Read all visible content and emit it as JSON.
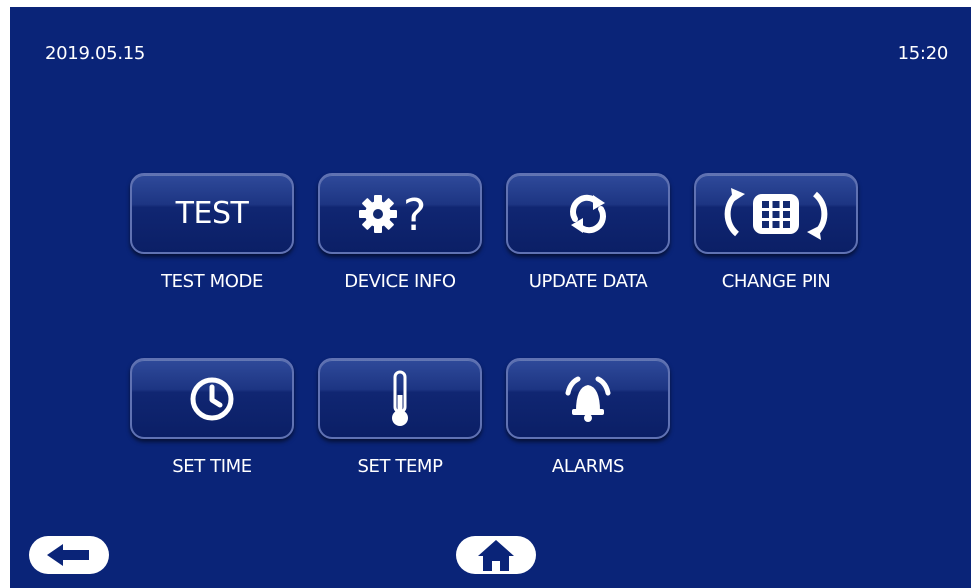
{
  "status": {
    "date": "2019.05.15",
    "time": "15:20"
  },
  "tiles": [
    {
      "tile_text": "TEST",
      "caption": "TEST MODE",
      "icon": "test-text"
    },
    {
      "caption": "DEVICE INFO",
      "icon": "gear-question-icon"
    },
    {
      "caption": "UPDATE DATA",
      "icon": "refresh-icon"
    },
    {
      "caption": "CHANGE PIN",
      "icon": "keypad-rotate-icon"
    },
    {
      "caption": "SET TIME",
      "icon": "clock-icon"
    },
    {
      "caption": "SET TEMP",
      "icon": "thermometer-icon"
    },
    {
      "caption": "ALARMS",
      "icon": "alarm-bell-icon"
    }
  ],
  "nav": {
    "back_icon": "arrow-left-icon",
    "home_icon": "home-icon"
  },
  "colors": {
    "background": "#0a2478",
    "tile_border": "#6072b3",
    "text": "#ffffff"
  }
}
